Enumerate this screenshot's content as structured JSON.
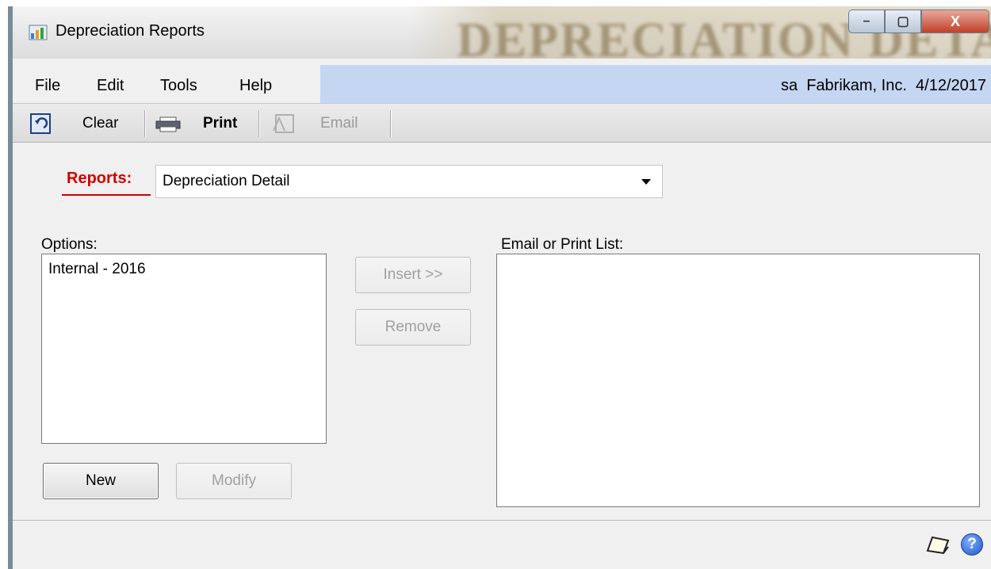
{
  "window": {
    "title": "Depreciation Reports",
    "background_banner": "DEPRECIATION DETAIL",
    "controls": {
      "minimize": "–",
      "maximize": "▢",
      "close": "X"
    }
  },
  "menu": {
    "items": [
      "File",
      "Edit",
      "Tools",
      "Help"
    ],
    "company_info": "sa  Fabrikam, Inc.  4/12/2017"
  },
  "toolbar": {
    "clear_label": "Clear",
    "print_label": "Print",
    "email_label": "Email"
  },
  "reports": {
    "label": "Reports:",
    "selected": "Depreciation Detail"
  },
  "options": {
    "label": "Options:",
    "items": [
      "Internal - 2016"
    ],
    "new_button": "New",
    "modify_button": "Modify"
  },
  "actions": {
    "insert_button": "Insert >>",
    "remove_button": "Remove"
  },
  "email_print_list": {
    "label": "Email or Print List:",
    "items": []
  },
  "colors": {
    "required_label": "#d40000",
    "menu_highlight": "#c5d6f2",
    "window_bg": "#f0f0f0"
  },
  "icons": [
    "app-icon",
    "restore-icon",
    "printer-icon",
    "email-icon",
    "note-icon",
    "help-icon"
  ]
}
